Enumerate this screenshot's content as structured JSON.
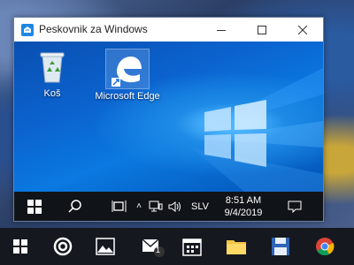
{
  "window": {
    "title": "Peskovnik za Windows"
  },
  "desktop": {
    "icons": [
      {
        "label": "Koš",
        "icon": "recycle-bin-icon"
      },
      {
        "label": "Microsoft Edge",
        "icon": "edge-icon"
      }
    ]
  },
  "inner_taskbar": {
    "language": "SLV",
    "time": "8:51 AM",
    "date": "9/4/2019"
  },
  "host_taskbar": {
    "items": [
      "start-icon",
      "cortana-icon",
      "photos-icon",
      "mail-icon",
      "calendar-icon",
      "file-explorer-icon",
      "save-app-icon",
      "chrome-icon"
    ],
    "mail_badge": "1"
  },
  "colors": {
    "inner_accent": "#0a6fd8",
    "taskbar": "#101418"
  }
}
